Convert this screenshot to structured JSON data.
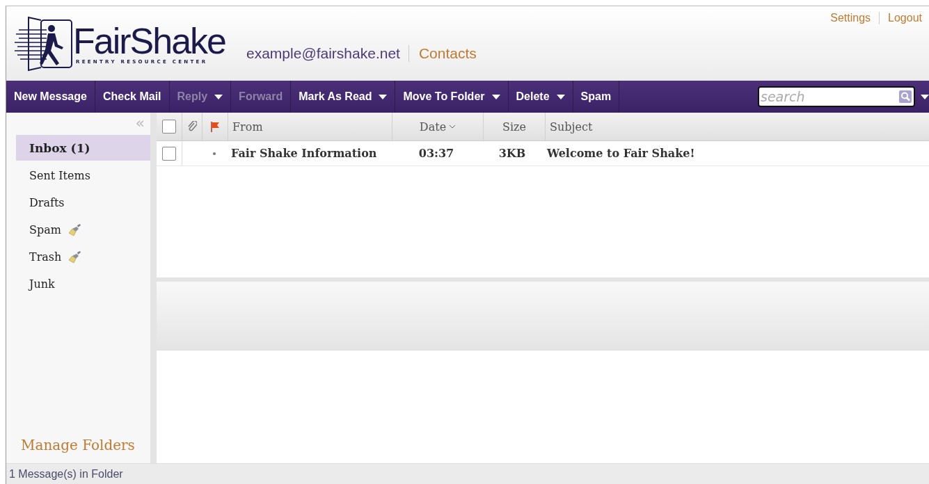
{
  "header": {
    "logo_name": "FairShake",
    "logo_tagline": "REENTRY RESOURCE CENTER",
    "account": "example@fairshake.net",
    "contacts_link": "Contacts",
    "top_links": [
      "Settings",
      "Logout"
    ]
  },
  "toolbar": {
    "buttons": [
      {
        "label": "New Message",
        "disabled": false,
        "has_menu": false
      },
      {
        "label": "Check Mail",
        "disabled": false,
        "has_menu": false
      },
      {
        "label": "Reply",
        "disabled": true,
        "has_menu": true
      },
      {
        "label": "Forward",
        "disabled": true,
        "has_menu": false
      },
      {
        "label": "Mark As Read",
        "disabled": false,
        "has_menu": true
      },
      {
        "label": "Move To Folder",
        "disabled": false,
        "has_menu": true
      },
      {
        "label": "Delete",
        "disabled": false,
        "has_menu": true
      },
      {
        "label": "Spam",
        "disabled": false,
        "has_menu": false
      }
    ],
    "search": {
      "placeholder": "search"
    }
  },
  "sidebar": {
    "collapse_icon": "«",
    "folders": [
      {
        "label": "Inbox (1)",
        "selected": true,
        "bold": true,
        "purge": false
      },
      {
        "label": "Sent Items",
        "selected": false,
        "bold": false,
        "purge": false
      },
      {
        "label": "Drafts",
        "selected": false,
        "bold": false,
        "purge": false
      },
      {
        "label": "Spam",
        "selected": false,
        "bold": false,
        "purge": true
      },
      {
        "label": "Trash",
        "selected": false,
        "bold": false,
        "purge": true
      },
      {
        "label": "Junk",
        "selected": false,
        "bold": false,
        "purge": false
      }
    ],
    "manage_link": "Manage Folders"
  },
  "table": {
    "select_all_checked": false,
    "columns": [
      "From",
      "Date",
      "Size",
      "Subject"
    ],
    "rows": [
      {
        "checked": false,
        "unread": true,
        "from": "Fair Shake Information",
        "date": "03:37",
        "size": "3KB",
        "subject": "Welcome to Fair Shake!"
      }
    ]
  },
  "status_bar": "1 Message(s) in Folder"
}
